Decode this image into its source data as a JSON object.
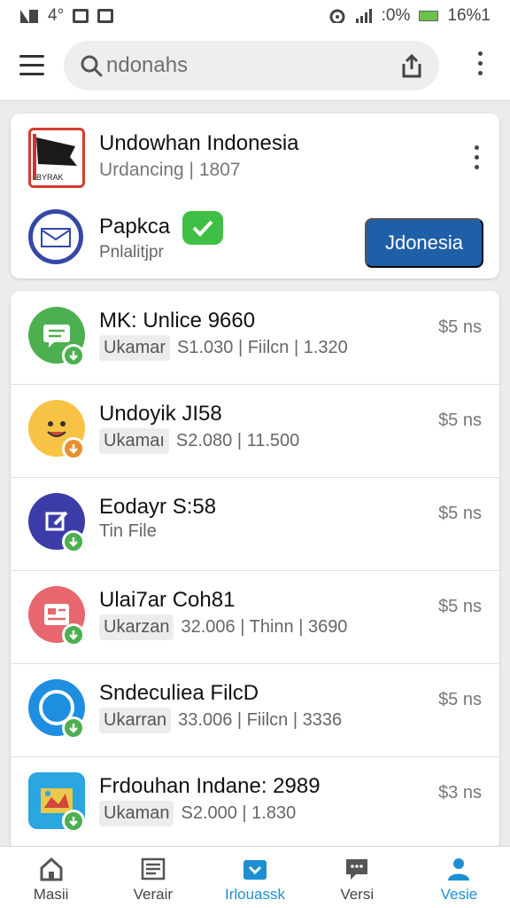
{
  "status_bar": {
    "left_text": "4°",
    "right_text": ":0%",
    "battery_text": "16%1"
  },
  "search": {
    "placeholder": "ndonahs"
  },
  "featured": {
    "title": "Undowhan Indonesia",
    "subtitle": "Urdancing | 1807",
    "second_title": "Papkca",
    "second_subtitle": "Pnlalitjpr",
    "logo_text": "BYRAK",
    "install_label": "Jdonesia"
  },
  "apps": [
    {
      "name": "MK: Unlice 9660",
      "tag": "Ukamar",
      "meta": "S1.030 | Fiilcn | 1.320",
      "price": "$5 ns",
      "icon_color": "#4caf50",
      "icon": "chat-icon"
    },
    {
      "name": "Undoyik JI58",
      "tag": "Ukamaı",
      "meta": "S2.080 | 11.500",
      "price": "$5 ns",
      "icon_color": "#f6c344",
      "icon": "emoji-icon"
    },
    {
      "name": "Eodayr S:58",
      "tag": "",
      "meta": "Tin File",
      "price": "$5 ns",
      "icon_color": "#3c3ca8",
      "icon": "edit-icon"
    },
    {
      "name": "Ulai7ar Coh81",
      "tag": "Ukarzan",
      "meta": "32.006 | Thinn | 3690",
      "price": "$5 ns",
      "icon_color": "#e8666e",
      "icon": "news-icon"
    },
    {
      "name": "Sndeculiea FilcD",
      "tag": "Ukarran",
      "meta": "33.006 | Fiilcn | 3336",
      "price": "$5 ns",
      "icon_color": "#1e8fe0",
      "icon": "circle-icon"
    },
    {
      "name": "Frdouhan Indane: 2989",
      "tag": "Ukaman",
      "meta": "S2.000 | 1.830",
      "price": "$3 ns",
      "icon_color": "#2aa6e0",
      "icon": "map-icon"
    }
  ],
  "bottom_nav": [
    {
      "label": "Masii",
      "icon": "home-icon"
    },
    {
      "label": "Verair",
      "icon": "list-icon"
    },
    {
      "label": "Irlouassk",
      "icon": "download-icon"
    },
    {
      "label": "Versi",
      "icon": "message-icon"
    },
    {
      "label": "Vesie",
      "icon": "person-icon"
    }
  ],
  "colors": {
    "accent": "#1d8fd0",
    "install_button": "#1f5fa8",
    "badge_green": "#4caf50"
  }
}
